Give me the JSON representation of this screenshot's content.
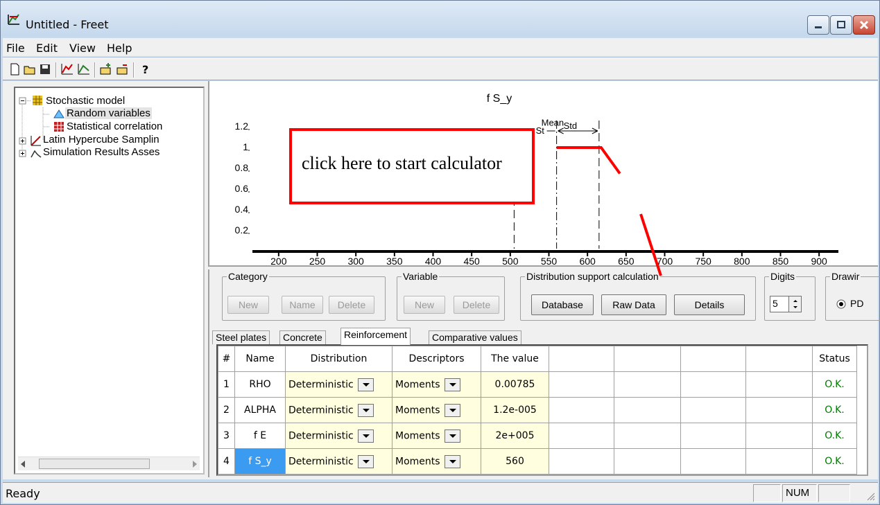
{
  "window": {
    "title": "Untitled - Freet"
  },
  "menu": [
    "File",
    "Edit",
    "View",
    "Help"
  ],
  "toolbar_icons": [
    "new-file-icon",
    "open-folder-icon",
    "save-icon",
    "chart-icon",
    "chart-alt-icon",
    "grid-add-icon",
    "grid-remove-icon",
    "help-icon"
  ],
  "tree": {
    "root": "Stochastic model",
    "children": [
      "Random variables",
      "Statistical correlation"
    ],
    "others": [
      "Latin Hypercube Samplin",
      "Simulation Results Asses"
    ]
  },
  "chart_data": {
    "type": "line",
    "title": "f S_y",
    "xlabel": "",
    "ylabel": "",
    "x_ticks": [
      "200",
      "250",
      "300",
      "350",
      "400",
      "450",
      "500",
      "550",
      "600",
      "650",
      "700",
      "750",
      "800",
      "850",
      "900"
    ],
    "y_ticks": [
      "1.2",
      "1",
      "0.8",
      "0.6",
      "0.4",
      "0.2"
    ],
    "xlim": [
      175,
      925
    ],
    "ylim": [
      0,
      1.3
    ],
    "annotations": [
      "Mean",
      "Std",
      "St"
    ],
    "markers": {
      "mean": 560,
      "minus_std": 505,
      "plus_std": 615
    }
  },
  "callout": {
    "text": "click here to start calculator"
  },
  "groups": {
    "category": {
      "label": "Category",
      "buttons": [
        "New",
        "Name",
        "Delete"
      ]
    },
    "variable": {
      "label": "Variable",
      "buttons": [
        "New",
        "Delete"
      ]
    },
    "dist": {
      "label": "Distribution support calculation",
      "buttons": [
        "Database",
        "Raw Data",
        "Details"
      ]
    },
    "digits": {
      "label": "Digits",
      "value": "5"
    },
    "drawing": {
      "label": "Drawir",
      "option": "PD"
    }
  },
  "tabs": [
    "Steel plates",
    "Concrete",
    "Reinforcement",
    "Comparative values"
  ],
  "table": {
    "headers": [
      "#",
      "Name",
      "Distribution",
      "Descriptors",
      "The value",
      "",
      "",
      "",
      "",
      "Status"
    ],
    "rows": [
      {
        "n": "1",
        "name": "RHO",
        "dist": "Deterministic",
        "desc": "Moments",
        "value": "0.00785",
        "status": "O.K."
      },
      {
        "n": "2",
        "name": "ALPHA",
        "dist": "Deterministic",
        "desc": "Moments",
        "value": "1.2e-005",
        "status": "O.K."
      },
      {
        "n": "3",
        "name": "f E",
        "dist": "Deterministic",
        "desc": "Moments",
        "value": "2e+005",
        "status": "O.K."
      },
      {
        "n": "4",
        "name": "f S_y",
        "dist": "Deterministic",
        "desc": "Moments",
        "value": "560",
        "status": "O.K."
      }
    ]
  },
  "status_bar": {
    "text": "Ready",
    "num": "NUM"
  },
  "colors": {
    "callout": "#ff0000",
    "status_ok": "#007a00",
    "selected_cell": "#3b9bf0",
    "value_cell": "#ffffe0"
  }
}
